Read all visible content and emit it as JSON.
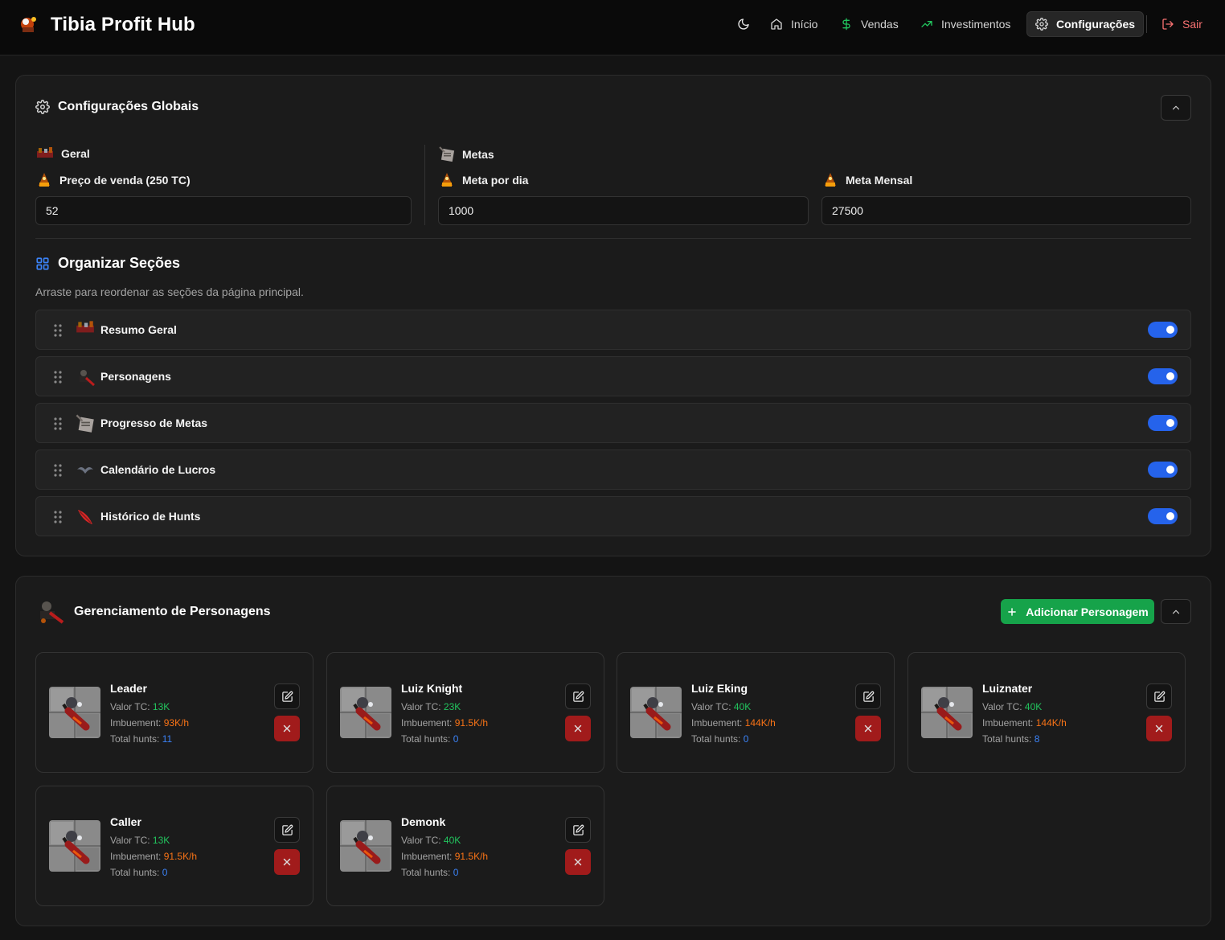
{
  "app": {
    "title": "Tibia Profit Hub"
  },
  "nav": {
    "items": [
      {
        "label": "Início"
      },
      {
        "label": "Vendas"
      },
      {
        "label": "Investimentos"
      },
      {
        "label": "Configurações"
      }
    ],
    "logout": "Sair",
    "active": "Configurações"
  },
  "global": {
    "title": "Configurações Globais",
    "general_heading": "Geral",
    "goals_heading": "Metas",
    "sale_price_label": "Preço de venda (250 TC)",
    "sale_price_value": "52",
    "daily_goal_label": "Meta por dia",
    "daily_goal_value": "1000",
    "monthly_goal_label": "Meta Mensal",
    "monthly_goal_value": "27500"
  },
  "organize": {
    "title": "Organizar Seções",
    "subtitle": "Arraste para reordenar as seções da página principal.",
    "sections": [
      {
        "label": "Resumo Geral",
        "enabled": true
      },
      {
        "label": "Personagens",
        "enabled": true
      },
      {
        "label": "Progresso de Metas",
        "enabled": true
      },
      {
        "label": "Calendário de Lucros",
        "enabled": true
      },
      {
        "label": "Histórico de Hunts",
        "enabled": true
      }
    ]
  },
  "characters": {
    "title": "Gerenciamento de Personagens",
    "add_label": "Adicionar Personagem",
    "labels": {
      "tc": "Valor TC:",
      "imbuement": "Imbuement:",
      "hunts": "Total hunts:"
    },
    "list": [
      {
        "name": "Leader",
        "tc": "13K",
        "imbuement": "93K/h",
        "hunts": "11"
      },
      {
        "name": "Luiz Knight",
        "tc": "23K",
        "imbuement": "91.5K/h",
        "hunts": "0"
      },
      {
        "name": "Luiz Eking",
        "tc": "40K",
        "imbuement": "144K/h",
        "hunts": "0"
      },
      {
        "name": "Luiznater",
        "tc": "40K",
        "imbuement": "144K/h",
        "hunts": "8"
      },
      {
        "name": "Caller",
        "tc": "13K",
        "imbuement": "91.5K/h",
        "hunts": "0"
      },
      {
        "name": "Demonk",
        "tc": "40K",
        "imbuement": "91.5K/h",
        "hunts": "0"
      }
    ]
  },
  "colors": {
    "accent_blue": "#2563eb",
    "success_green": "#16a34a",
    "value_green": "#22c55e",
    "value_orange": "#f97316",
    "value_blue": "#3b82f6",
    "danger_red": "#b91c1c",
    "logout_red": "#f87171"
  }
}
